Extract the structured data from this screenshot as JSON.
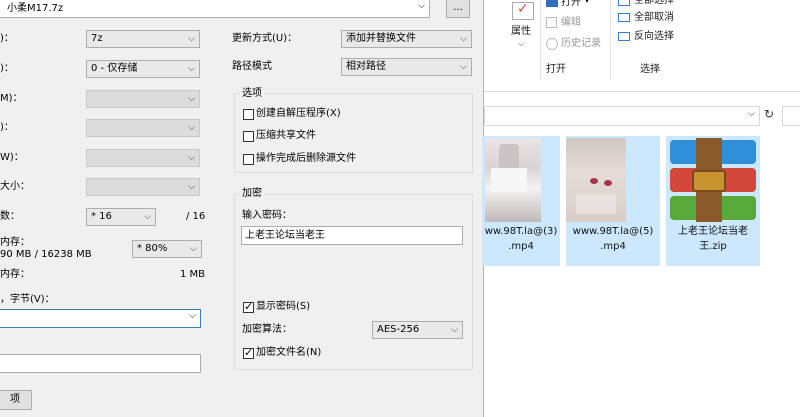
{
  "dialog": {
    "archive_name": "小柔M17.7z",
    "browse_label": "...",
    "left_labels": [
      ")：",
      ")：",
      "M)：",
      ")：",
      "W)：",
      "大小：",
      "数：",
      "内存：",
      "内存："
    ],
    "format_value": "7z",
    "level_value": "0 - 仅存储",
    "threads_value": "* 16",
    "threads_max": "/ 16",
    "memory_usage_text": "90 MB / 16238 MB",
    "memory_percent_value": "* 80%",
    "decompress_memory_text": "1 MB",
    "split_label": "，字节(V)：",
    "bottom_button": "项",
    "update_mode_label": "更新方式(U)：",
    "update_mode_value": "添加并替换文件",
    "path_mode_label": "路径模式",
    "path_mode_value": "相对路径",
    "options_title": "选项",
    "options": [
      {
        "label": "创建自解压程序(X)",
        "checked": false
      },
      {
        "label": "压缩共享文件",
        "checked": false
      },
      {
        "label": "操作完成后删除源文件",
        "checked": false
      }
    ],
    "encryption_title": "加密",
    "password_label": "输入密码：",
    "password_value": "上老王论坛当老王",
    "show_password_label": "显示密码(S)",
    "encryption_method_label": "加密算法：",
    "encryption_method_value": "AES-256",
    "encrypt_names_label": "加密文件名(N)"
  },
  "ribbon": {
    "properties_label": "属性",
    "open_label": "打开",
    "edit_label": "编辑",
    "history_label": "历史记录",
    "select_all_label": "全部选择",
    "select_none_label": "全部取消",
    "invert_label": "反向选择",
    "group_open": "打开",
    "group_select": "选择"
  },
  "files": [
    {
      "name_lines": [
        "ww.98T.la@(3)",
        ".mp4"
      ]
    },
    {
      "name_lines": [
        "www.98T.la@(5)",
        ".mp4"
      ]
    },
    {
      "name_lines": [
        "上老王论坛当老",
        "王.zip"
      ]
    }
  ],
  "colors": {
    "selection": "#cce8ff",
    "dialog_bg": "#f0f0f0",
    "winrar_red": "#d2483a",
    "winrar_green": "#58a83a",
    "winrar_blue": "#2f8fd8"
  }
}
